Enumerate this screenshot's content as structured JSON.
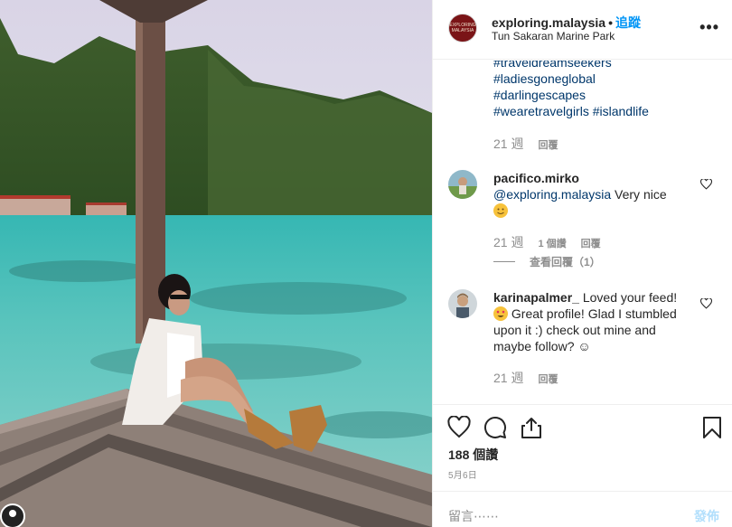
{
  "post": {
    "username": "exploring.malaysia",
    "separator": "•",
    "follow_label": "追蹤",
    "location": "Tun Sakaran Marine Park",
    "more_label": "•••",
    "avatar_text": "EXPLORING MALAYSIA"
  },
  "caption": {
    "hashtags": [
      "#traveldreamseekers",
      "#ladiesgoneglobal",
      "#darlingescapes",
      "#wearetravelgirls #islandlife"
    ],
    "time": "21 週",
    "reply_label": "回覆"
  },
  "comments": [
    {
      "name": "pacifico.mirko",
      "mention": "@exploring.malaysia",
      "text": " Very nice",
      "emoji": "slightly-smiling-face",
      "time": "21 週",
      "likes": "1 個讚",
      "reply_label": "回覆",
      "view_replies": "查看回覆（1）"
    },
    {
      "name": "karinapalmer_",
      "text_before": " Loved your feed!",
      "emoji": "heart-eyes-face",
      "text_after": " Great profile! Glad I stumbled upon it :) check out mine and maybe follow? ☺",
      "time": "21 週",
      "reply_label": "回覆"
    }
  ],
  "actions": {
    "like_icon": "heart-icon",
    "comment_icon": "comment-icon",
    "share_icon": "share-icon",
    "save_icon": "bookmark-icon",
    "likes": "188 個讚",
    "date": "5月6日"
  },
  "add_comment": {
    "placeholder": "留言⋯⋯",
    "post_label": "發佈"
  },
  "colors": {
    "link": "#00376b",
    "follow": "#0095f6",
    "muted": "#8e8e8e",
    "post_disabled": "#b2dffc"
  }
}
